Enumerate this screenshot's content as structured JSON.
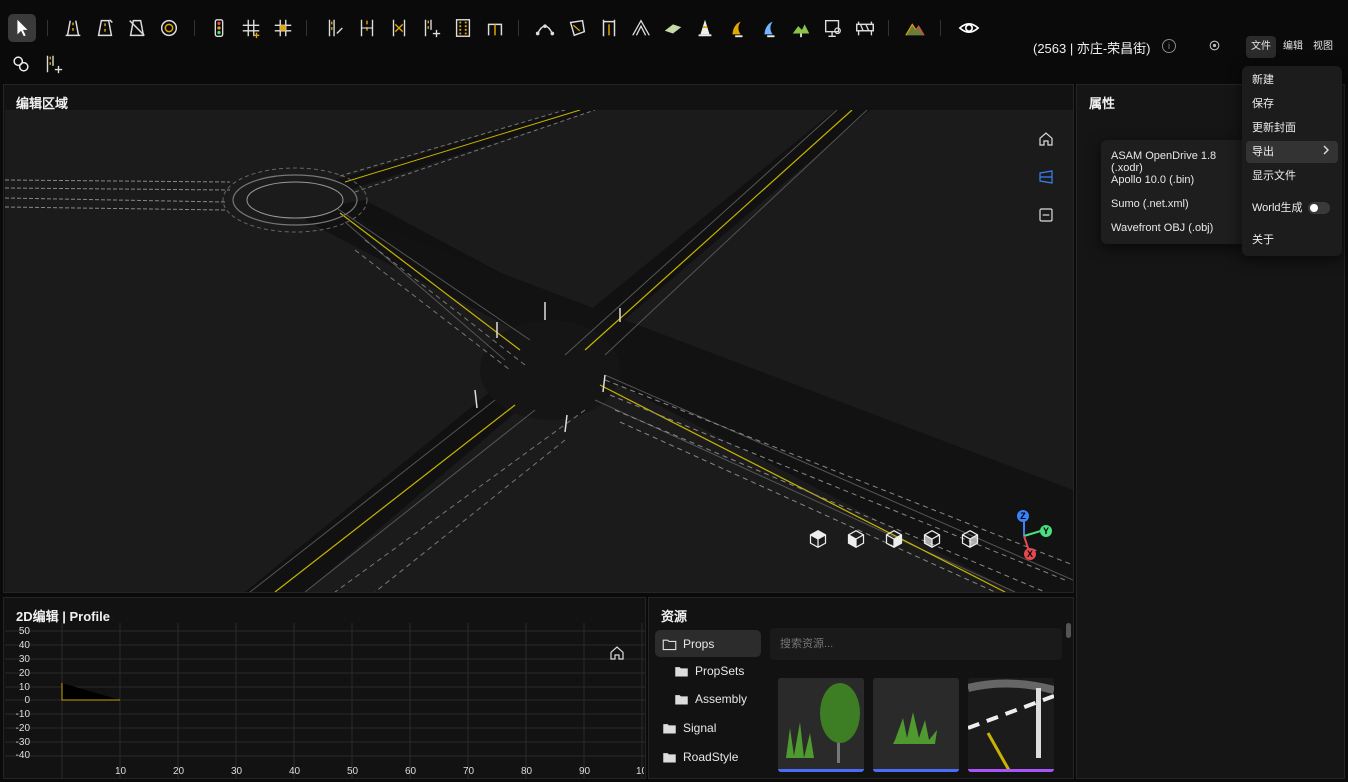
{
  "header": {
    "project": "(2563 | 亦庄-荣昌街)",
    "menus": [
      "文件",
      "编辑",
      "视图"
    ]
  },
  "toolbar": {
    "row1": [
      "pointer-icon",
      "road-icon",
      "road-edit-icon",
      "road-delete-icon",
      "roundabout-icon",
      "traffic-light-icon",
      "junction-add-icon",
      "junction-edit-icon",
      "lane-add-icon",
      "lane-width-icon",
      "lane-offset-icon",
      "lane-split-icon",
      "lane-marking-icon",
      "lane-link-icon",
      "curve-icon",
      "polygon-icon",
      "bridge-icon",
      "tunnel-icon",
      "crosswalk-icon",
      "cone-icon",
      "pole-icon",
      "sign-icon",
      "tree-icon",
      "billboard-icon",
      "barrier-icon",
      "terrain-icon",
      "eye-icon"
    ],
    "row2": [
      "link-icon",
      "lane-insert-icon"
    ]
  },
  "editor": {
    "title": "编辑区域",
    "view_buttons": [
      "home-icon",
      "perspective-icon",
      "minimize-icon"
    ],
    "camera_cubes": [
      "cube-top-icon",
      "cube-front-icon",
      "cube-right-icon",
      "cube-left-icon",
      "cube-back-icon"
    ],
    "axes": {
      "x": "X",
      "y": "Y",
      "z": "Z"
    }
  },
  "properties": {
    "title": "属性"
  },
  "file_menu": {
    "items": [
      "新建",
      "保存",
      "更新封面",
      "导出",
      "显示文件",
      "World生成",
      "关于"
    ],
    "world_toggle": false
  },
  "export_submenu": {
    "items": [
      "ASAM OpenDrive 1.8 (.xodr)",
      "Apollo 10.0 (.bin)",
      "Sumo (.net.xml)",
      "Wavefront OBJ (.obj)"
    ]
  },
  "profile": {
    "title": "2D编辑 | Profile",
    "y_ticks": [
      "50",
      "40",
      "30",
      "20",
      "10",
      "0",
      "-10",
      "-20",
      "-30",
      "-40"
    ],
    "x_ticks": [
      "10",
      "20",
      "30",
      "40",
      "50",
      "60",
      "70",
      "80",
      "90",
      "10"
    ]
  },
  "resources": {
    "title": "资源",
    "tree": [
      "Props",
      "PropSets",
      "Assembly",
      "Signal",
      "RoadStyle"
    ],
    "search_placeholder": "搜索资源...",
    "accent": "#4a6cf7"
  },
  "colors": {
    "lane_yellow": "#c8b400",
    "accent_blue": "#3b82f6",
    "axis_x": "#e5484d",
    "axis_y": "#4ade80",
    "axis_z": "#3b82f6"
  }
}
